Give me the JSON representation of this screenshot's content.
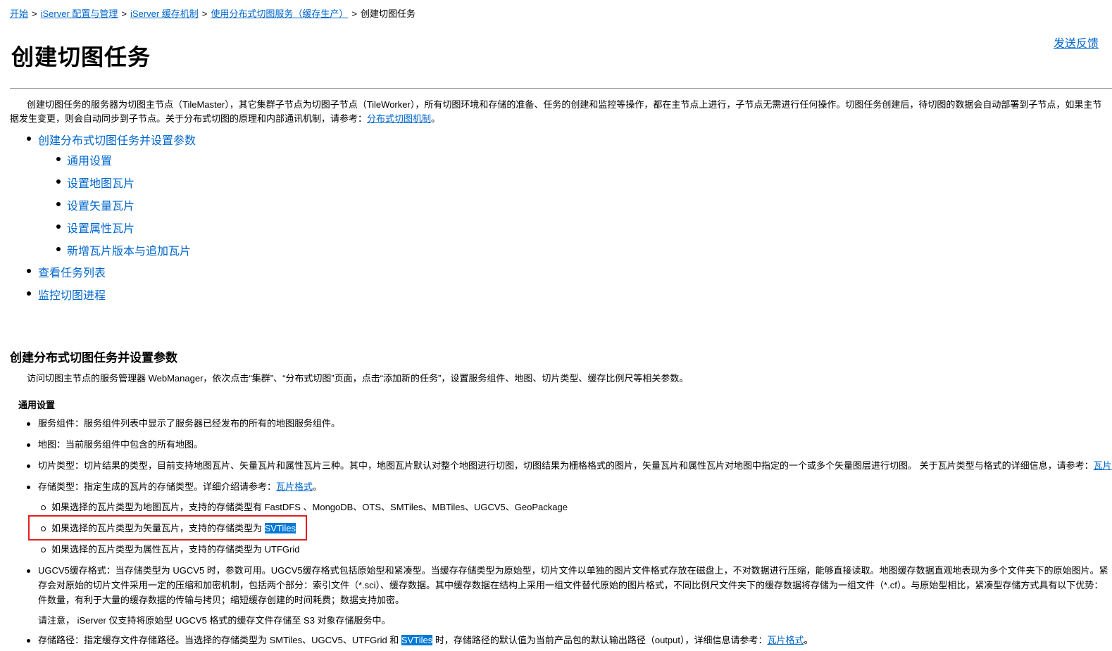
{
  "breadcrumb": {
    "items": [
      "开始",
      "iServer 配置与管理",
      "iServer 缓存机制",
      "使用分布式切图服务（缓存生产）"
    ],
    "current": "创建切图任务",
    "separator": ">"
  },
  "feedback_label": "发送反馈",
  "page_title": "创建切图任务",
  "intro": {
    "line1": "创建切图任务的服务器为切图主节点（TileMaster），其它集群子节点为切图子节点（TileWorker），所有切图环境和存储的准备、任务的创建和监控等操作，都在主节点上进行，子节点无需进行任何操作。切图任务创建后，待切图的数据会自动部署到子节点，如果主节",
    "line2_prefix": "据发生变更，则会自动同步到子节点。关于分布式切图的原理和内部通讯机制，请参考：",
    "line2_link": "分布式切图机制",
    "line2_suffix": "。"
  },
  "toc": {
    "items": [
      {
        "label": "创建分布式切图任务并设置参数",
        "level": 1
      },
      {
        "label": "通用设置",
        "level": 2
      },
      {
        "label": "设置地图瓦片",
        "level": 2
      },
      {
        "label": "设置矢量瓦片",
        "level": 2
      },
      {
        "label": "设置属性瓦片",
        "level": 2
      },
      {
        "label": "新增瓦片版本与追加瓦片",
        "level": 2
      },
      {
        "label": "查看任务列表",
        "level": 1
      },
      {
        "label": "监控切图进程",
        "level": 1
      }
    ]
  },
  "section": {
    "heading": "创建分布式切图任务并设置参数",
    "intro": "访问切图主节点的服务管理器 WebManager，依次点击“集群”、“分布式切图”页面，点击“添加新的任务”，设置服务组件、地图、切片类型、缓存比例尺等相关参数。",
    "sub_heading": "通用设置",
    "items": {
      "service": "服务组件：服务组件列表中显示了服务器已经发布的所有的地图服务组件。",
      "map": "地图：当前服务组件中包含的所有地图。",
      "tile_type_text": "切片类型：切片结果的类型，目前支持地图瓦片、矢量瓦片和属性瓦片三种。其中，地图瓦片默认对整个地图进行切图，切图结果为栅格格式的图片，矢量瓦片和属性瓦片对地图中指定的一个或多个矢量图层进行切图。 关于瓦片类型与格式的详细信息，请参考：",
      "tile_type_link": "瓦片",
      "storage_text": "存储类型：指定生成的瓦片的存储类型。详细介绍请参考：",
      "storage_link": "瓦片格式",
      "storage_suffix": "。",
      "sub_map": "如果选择的瓦片类型为地图瓦片，支持的存储类型有 FastDFS 、MongoDB、OTS、SMTiles、MBTiles、UGCV5、GeoPackage",
      "sub_vector_text": "如果选择的瓦片类型为矢量瓦片，支持的存储类型为 ",
      "sub_vector_hl": "SVTiles",
      "sub_attr": "如果选择的瓦片类型为属性瓦片，支持的存储类型为 UTFGrid",
      "ugcv5_line1": "UGCV5缓存格式：当存储类型为 UGCV5 时，参数可用。UGCV5缓存格式包括原始型和紧凑型。当缓存存储类型为原始型，切片文件以单独的图片文件格式存放在磁盘上，不对数据进行压缩，能够直接读取。地图缓存数据直观地表现为多个文件夹下的原始图片。紧",
      "ugcv5_line2": "存会对原始的切片文件采用一定的压缩和加密机制，包括两个部分：索引文件（*.sci）、缓存数据。其中缓存数据在结构上采用一组文件替代原始的图片格式，不同比例尺文件夹下的缓存数据将存储为一组文件（*.cf）。与原始型相比，紧凑型存储方式具有以下优势：",
      "ugcv5_line3": "件数量，有利于大量的缓存数据的传输与拷贝；缩短缓存创建的时间耗费；数据支持加密。",
      "note": "请注意， iServer 仅支持将原始型 UGCV5 格式的缓存文件存储至 S3 对象存储服务中。",
      "path_text": "存储路径：指定缓存文件存储路径。当选择的存储类型为 SMTiles、UGCV5、UTFGrid 和 ",
      "path_hl": "SVTiles",
      "path_text2": " 时，存储路径的默认值为当前产品包的默认输出路径（output），详细信息请参考：",
      "path_link": "瓦片格式",
      "path_suffix": "。"
    }
  },
  "colors": {
    "link": "#0066cc",
    "highlight": "#0078d7",
    "annotation_box": "#e02020"
  }
}
